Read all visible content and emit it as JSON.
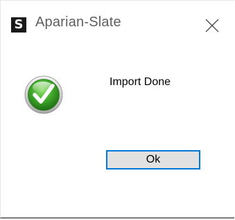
{
  "window": {
    "app_icon_glyph": "S",
    "title": "Aparian-Slate",
    "close_icon": "close-icon",
    "accent_color": "#0078d7"
  },
  "dialog": {
    "status_icon": "success-check-icon",
    "message": "Import Done",
    "ok_label": "Ok"
  }
}
